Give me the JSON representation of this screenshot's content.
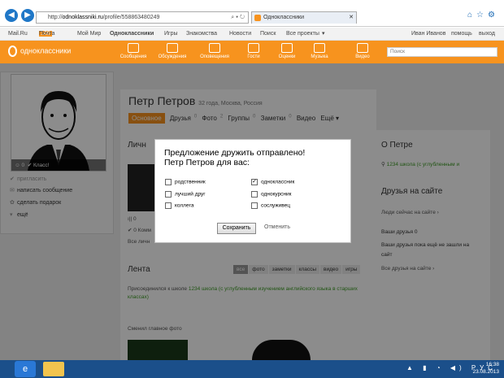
{
  "browser": {
    "address": "http://",
    "address_host": "odnoklassniki.ru",
    "address_path": "/profile/558863480249",
    "tab_title": "Одноклассники"
  },
  "topnav": {
    "links": [
      "Mail.Ru",
      "Почта",
      "Мой Мир",
      "Одноклассники",
      "Игры",
      "Знакомства",
      "Новости",
      "Поиск",
      "Все проекты"
    ],
    "mail_count": "100",
    "user": "Иван Иванов",
    "help": "помощь",
    "exit": "выход"
  },
  "toolbar": {
    "logo": "одноклассники",
    "items": [
      "Сообщения",
      "Обсуждения",
      "Оповещения",
      "Гости",
      "Оценки",
      "Музыка",
      "Видео"
    ],
    "search_placeholder": "Поиск"
  },
  "profile": {
    "name": "Петр Петров",
    "meta": "32 года, Москва, Россия",
    "tabs": [
      {
        "label": "Основное",
        "count": ""
      },
      {
        "label": "Друзья",
        "count": "0"
      },
      {
        "label": "Фото",
        "count": "2"
      },
      {
        "label": "Группы",
        "count": "0"
      },
      {
        "label": "Заметки",
        "count": "0"
      },
      {
        "label": "Видео",
        "count": ""
      },
      {
        "label": "Ещё ▾",
        "count": ""
      }
    ],
    "photo_stats": "0",
    "photo_class": "Класс!",
    "left_actions": [
      "пригласить",
      "написать сообщение",
      "сделать подарок",
      "ещё"
    ]
  },
  "main": {
    "personal_heading": "Личн",
    "friend_counts": "0",
    "class_count": "0 Комм",
    "all_personal": "Все личн",
    "feed_heading": "Лента",
    "feed_tabs": [
      "все",
      "фото",
      "заметки",
      "классы",
      "видео",
      "игры"
    ],
    "feed_item1_prefix": "Присоединился к школе",
    "feed_item1_link": "1234 школа (с углубленным изучением английского языка в старших классах)",
    "feed_item2": "Сменил главное фото"
  },
  "sidebar": {
    "about_heading": "О Петре",
    "school": "1234 школа (с углубленным и",
    "friends_heading": "Друзья на сайте",
    "people_now": "Люди сейчас на сайте",
    "your_friends": "Ваши друзья 0",
    "not_online_l1": "Ваши друзья пока ещё не зашли на",
    "not_online_l2": "сайт",
    "all_friends": "Все друзья на сайте"
  },
  "dialog": {
    "title_line1": "Предложение дружить отправлено!",
    "title_line2": "Петр Петров для вас:",
    "options_left": [
      "родственник",
      "лучший друг",
      "коллега"
    ],
    "options_right": [
      "одноклассник",
      "однокурсник",
      "сослуживец"
    ],
    "checked": "одноклассник",
    "save_label": "Сохранить",
    "cancel_label": "Отменить"
  },
  "taskbar": {
    "lang": "РУС",
    "time": "16:38",
    "date": "23.08.2013"
  },
  "colors": {
    "brand": "#f7931e",
    "link_green": "#3d9b25",
    "taskbar": "#1b4f8a"
  }
}
